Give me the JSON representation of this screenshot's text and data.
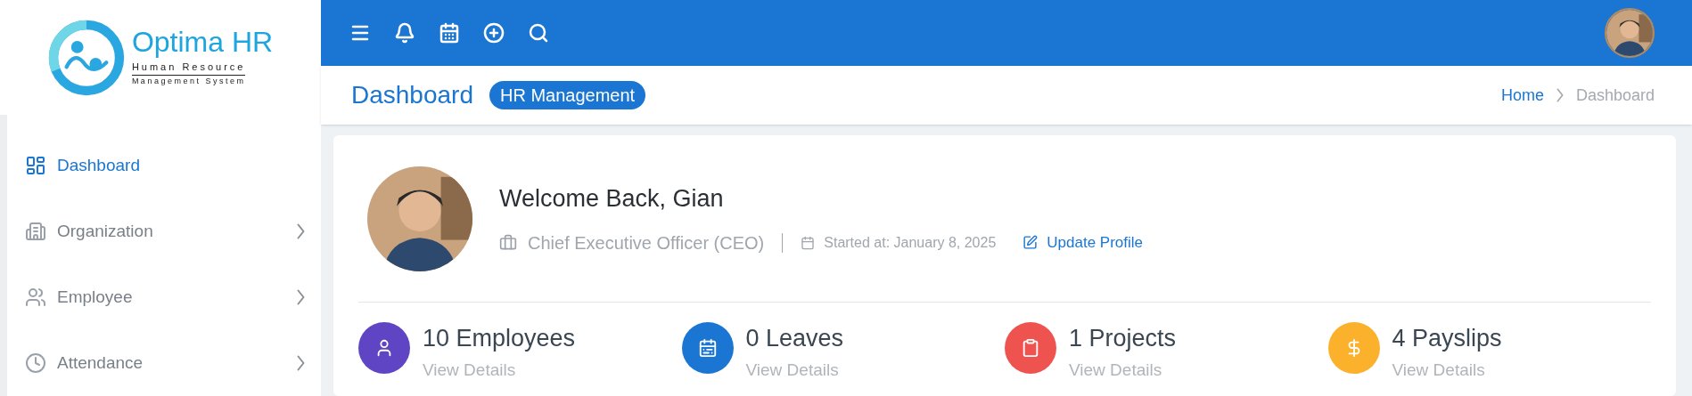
{
  "logo": {
    "name": "Optima HR",
    "tagline_1": "Human Resource",
    "tagline_2": "Management System"
  },
  "sidebar": {
    "items": [
      {
        "label": "Dashboard",
        "kind": "dashboard",
        "selected": true,
        "submenu": false
      },
      {
        "label": "Organization",
        "kind": "building",
        "selected": false,
        "submenu": true
      },
      {
        "label": "Employee",
        "kind": "people",
        "selected": false,
        "submenu": true
      },
      {
        "label": "Attendance",
        "kind": "clock",
        "selected": false,
        "submenu": true
      }
    ]
  },
  "page_header": {
    "title": "Dashboard",
    "badge": "HR Management",
    "breadcrumb": [
      {
        "label": "Home",
        "selected": false
      },
      {
        "label": "Dashboard",
        "selected": true
      }
    ]
  },
  "profile": {
    "greeting": "Welcome Back, Gian",
    "role": "Chief Executive Officer (CEO)",
    "started": "Started at: January 8, 2025",
    "update_link": "Update Profile"
  },
  "stats": [
    {
      "title": "10 Employees",
      "link": "View Details",
      "kind": "person",
      "color": "#5f45c4"
    },
    {
      "title": "0 Leaves",
      "link": "View Details",
      "kind": "calendar",
      "color": "#1a76d2"
    },
    {
      "title": "1 Projects",
      "link": "View Details",
      "kind": "clipboard",
      "color": "#ef5350"
    },
    {
      "title": "4 Payslips",
      "link": "View Details",
      "kind": "dollar",
      "color": "#fbb12b"
    }
  ]
}
